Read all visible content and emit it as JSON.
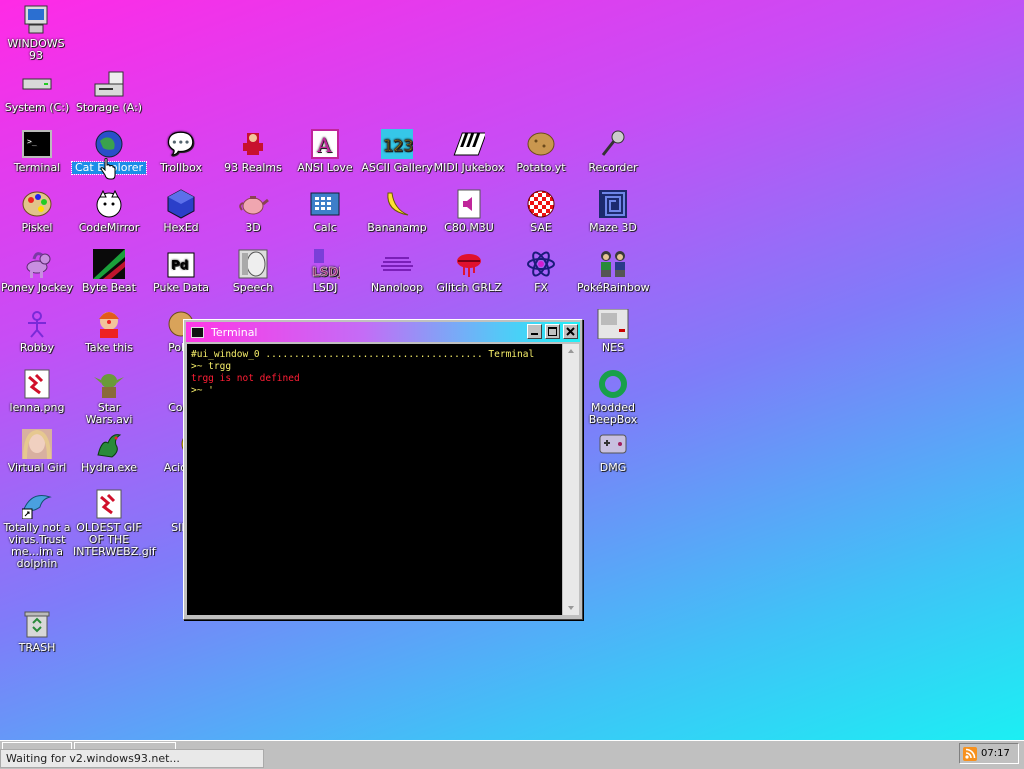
{
  "desktop": {
    "icons": [
      {
        "label": "WINDOWS 93",
        "glyph": "🖥"
      },
      {
        "label": "System (C:)",
        "glyph": "▬"
      },
      {
        "label": "Storage (A:)",
        "glyph": "💾"
      },
      {
        "label": "Terminal",
        "glyph": "▣"
      },
      {
        "label": "Cat Explorer",
        "glyph": "🌐"
      },
      {
        "label": "Trollbox",
        "glyph": "💬"
      },
      {
        "label": "93 Realms",
        "glyph": "🧙"
      },
      {
        "label": "ANSI Love",
        "glyph": "A"
      },
      {
        "label": "ASCII Gallery",
        "glyph": "123"
      },
      {
        "label": "MIDI Jukebox",
        "glyph": "🎹"
      },
      {
        "label": "Potato.yt",
        "glyph": "🥔"
      },
      {
        "label": "Recorder",
        "glyph": "🎤"
      },
      {
        "label": "Piskel",
        "glyph": "🎨"
      },
      {
        "label": "CodeMirror",
        "glyph": "🐱"
      },
      {
        "label": "HexEd",
        "glyph": "⬢"
      },
      {
        "label": "3D",
        "glyph": "🫖"
      },
      {
        "label": "Calc",
        "glyph": "🧮"
      },
      {
        "label": "Bananamp",
        "glyph": "🍌"
      },
      {
        "label": "C80.M3U",
        "glyph": "🔈"
      },
      {
        "label": "SAE",
        "glyph": "🔴"
      },
      {
        "label": "Maze 3D",
        "glyph": "▦"
      },
      {
        "label": "Poney Jockey",
        "glyph": "🦄"
      },
      {
        "label": "Byte Beat",
        "glyph": "◤"
      },
      {
        "label": "Puke Data",
        "glyph": "Pd"
      },
      {
        "label": "Speech",
        "glyph": "🗣"
      },
      {
        "label": "LSDJ",
        "glyph": "🎮"
      },
      {
        "label": "Nanoloop",
        "glyph": "≋"
      },
      {
        "label": "Glitch GRLZ",
        "glyph": "👄"
      },
      {
        "label": "FX",
        "glyph": "⚛"
      },
      {
        "label": "PokéRainbow",
        "glyph": "👥"
      },
      {
        "label": "Robby",
        "glyph": "☺"
      },
      {
        "label": "Take this",
        "glyph": "🤡"
      },
      {
        "label": "Poke",
        "glyph": "🍪"
      },
      {
        "label": "NES",
        "glyph": "▤"
      },
      {
        "label": "lenna.png",
        "glyph": "🖼"
      },
      {
        "label": "Star Wars.avi",
        "glyph": "👽"
      },
      {
        "label": "Corg",
        "glyph": "🐶"
      },
      {
        "label": "Modded BeepBox",
        "glyph": "◯"
      },
      {
        "label": "Virtual Girl",
        "glyph": "👩"
      },
      {
        "label": "Hydra.exe",
        "glyph": "🐉"
      },
      {
        "label": "Acid B",
        "glyph": "☻"
      },
      {
        "label": "DMG",
        "glyph": "🎮"
      },
      {
        "label": "Totally not a virus.Trust me...im a dolphin",
        "glyph": "🐬"
      },
      {
        "label": "OLDEST GIF OF THE INTERWEBZ.gif",
        "glyph": "🖼"
      },
      {
        "label": "SIM",
        "glyph": "👤"
      },
      {
        "label": "TRASH",
        "glyph": "🗑"
      }
    ]
  },
  "terminal": {
    "title": "Terminal",
    "lines": [
      "#ui_window_0 ...................................... Terminal",
      ">~ trgg",
      "trgg is not defined",
      ">~ '"
    ]
  },
  "status": {
    "text": "Waiting for v2.windows93.net..."
  },
  "tray": {
    "time": "07:17"
  },
  "colors": {
    "accent": "#1b8ee8",
    "error": "#ff1e35",
    "prompt": "#f7ef6a"
  }
}
